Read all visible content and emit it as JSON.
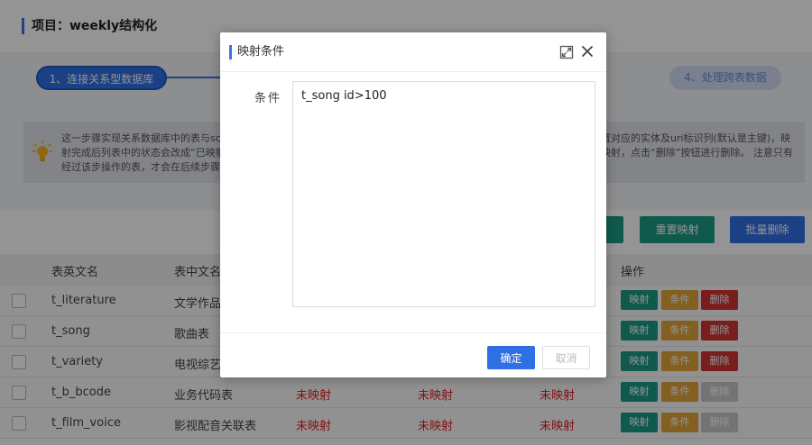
{
  "project": {
    "title": "项目：weekly结构化"
  },
  "steps": [
    {
      "label": "1、连接关系型数据库"
    },
    {
      "label": "4、处理跨表数据"
    }
  ],
  "info": {
    "line1_left": "这一步骤实现关系数据库中的表与sch",
    "line1_right": "置对应的实体及uri标识列(默认是主键)，映",
    "line2_left": "射完成后列表中的状态会改成“已映射",
    "line2_right": "映射，点击“删除”按钮进行删除。 注意只有",
    "line3_left": "经过该步操作的表，才会在后续步骤中"
  },
  "toolbar": {
    "reset_label": "重置映射",
    "batch_delete_label": "批量删除"
  },
  "table": {
    "headers": {
      "en_name": "表英文名",
      "cn_name": "表中文名",
      "ops": "操作"
    },
    "rows": [
      {
        "en": "t_literature",
        "cn": "文学作品",
        "s1": "",
        "s2": "",
        "s3": "",
        "delete_enabled": true
      },
      {
        "en": "t_song",
        "cn": "歌曲表",
        "s1": "",
        "s2": "",
        "s3": "",
        "delete_enabled": true
      },
      {
        "en": "t_variety",
        "cn": "电视综艺",
        "s1": "",
        "s2": "",
        "s3": "",
        "delete_enabled": true
      },
      {
        "en": "t_b_bcode",
        "cn": "业务代码表",
        "s1": "未映射",
        "s2": "未映射",
        "s3": "未映射",
        "delete_enabled": false
      },
      {
        "en": "t_film_voice",
        "cn": "影视配音关联表",
        "s1": "未映射",
        "s2": "未映射",
        "s3": "未映射",
        "delete_enabled": false
      }
    ],
    "op_labels": {
      "map": "映射",
      "cond": "条件",
      "del": "删除"
    }
  },
  "dialog": {
    "title": "映射条件",
    "condition_label": "条件",
    "condition_value": "t_song id>100",
    "ok_label": "确定",
    "cancel_label": "取消"
  },
  "colors": {
    "primary": "#2f6fe4",
    "teal": "#1a9c86",
    "orange": "#e2a63a",
    "danger": "#d33232",
    "status_red": "#e02020"
  }
}
